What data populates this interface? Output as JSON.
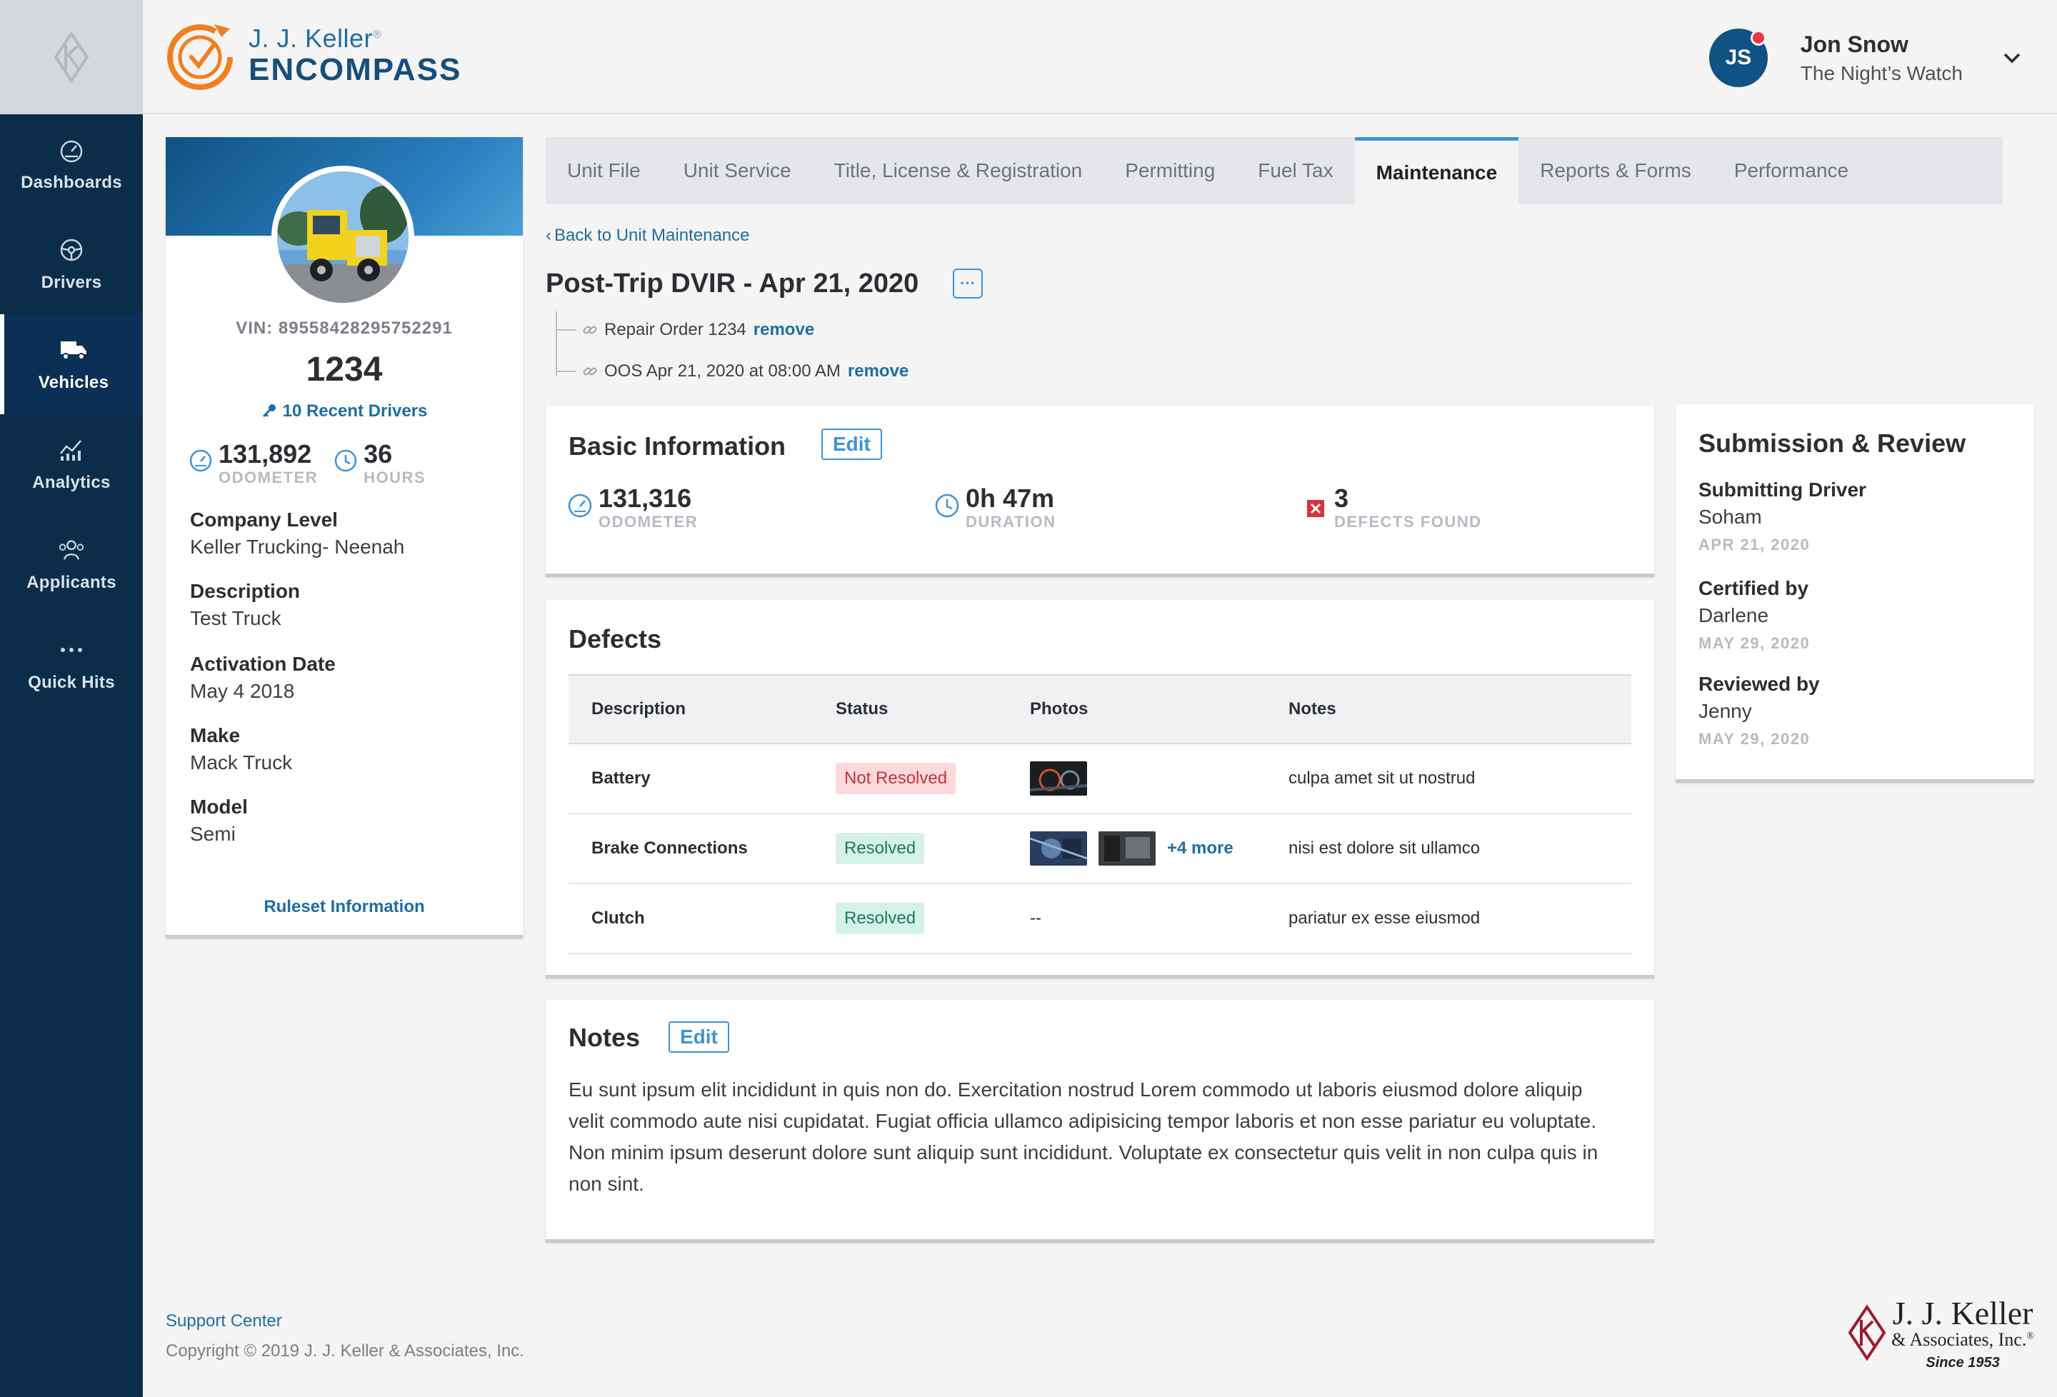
{
  "sidebar": {
    "items": [
      {
        "label": "Dashboards",
        "icon": "dashboard-icon"
      },
      {
        "label": "Drivers",
        "icon": "steering-wheel-icon"
      },
      {
        "label": "Vehicles",
        "icon": "truck-icon",
        "active": true
      },
      {
        "label": "Analytics",
        "icon": "analytics-icon"
      },
      {
        "label": "Applicants",
        "icon": "people-icon"
      },
      {
        "label": "Quick Hits",
        "icon": "ellipsis-icon"
      }
    ]
  },
  "header": {
    "brand_top": "J. J. Keller",
    "brand_reg": "®",
    "brand_bottom": "ENCOMPASS",
    "user": {
      "initials": "JS",
      "name": "Jon Snow",
      "org": "The Night’s Watch"
    }
  },
  "unit": {
    "vin": "VIN: 89558428295752291",
    "number": "1234",
    "recent_drivers": "10 Recent Drivers",
    "odometer_value": "131,892",
    "odometer_label": "ODOMETER",
    "hours_value": "36",
    "hours_label": "HOURS",
    "fields": [
      {
        "label": "Company Level",
        "value": "Keller Trucking- Neenah"
      },
      {
        "label": "Description",
        "value": "Test Truck"
      },
      {
        "label": "Activation Date",
        "value": "May 4 2018"
      },
      {
        "label": "Make",
        "value": "Mack Truck"
      },
      {
        "label": "Model",
        "value": "Semi"
      }
    ],
    "ruleset": "Ruleset Information"
  },
  "tabs": [
    {
      "label": "Unit File"
    },
    {
      "label": "Unit Service"
    },
    {
      "label": "Title, License & Registration"
    },
    {
      "label": "Permitting"
    },
    {
      "label": "Fuel Tax"
    },
    {
      "label": "Maintenance",
      "active": true
    },
    {
      "label": "Reports & Forms"
    },
    {
      "label": "Performance"
    }
  ],
  "page": {
    "back": "Back to Unit Maintenance",
    "title": "Post-Trip DVIR - Apr 21, 2020",
    "more": "···",
    "links": [
      {
        "text": "Repair Order 1234",
        "action": "remove"
      },
      {
        "text": "OOS Apr 21, 2020 at 08:00 AM",
        "action": "remove"
      }
    ]
  },
  "basic_info": {
    "title": "Basic Information",
    "edit": "Edit",
    "odometer_value": "131,316",
    "odometer_label": "ODOMETER",
    "duration_value": "0h 47m",
    "duration_label": "DURATION",
    "defects_value": "3",
    "defects_label": "DEFECTS FOUND"
  },
  "defects": {
    "title": "Defects",
    "columns": [
      "Description",
      "Status",
      "Photos",
      "Notes"
    ],
    "rows": [
      {
        "description": "Battery",
        "status": "Not Resolved",
        "photos": "",
        "notes": "culpa amet sit ut nostrud"
      },
      {
        "description": "Brake Connections",
        "status": "Resolved",
        "photos": "+4 more",
        "notes": "nisi est dolore sit ullamco"
      },
      {
        "description": "Clutch",
        "status": "Resolved",
        "photos": "--",
        "notes": "pariatur ex esse eiusmod"
      }
    ]
  },
  "notes": {
    "title": "Notes",
    "edit": "Edit",
    "text": "Eu sunt ipsum elit incididunt in quis non do. Exercitation nostrud Lorem commodo ut laboris eiusmod dolore aliquip velit commodo aute nisi cupidatat. Fugiat officia ullamco adipisicing tempor laboris et non esse pariatur eu voluptate. Non minim ipsum deserunt dolore sunt aliquip sunt incididunt. Voluptate ex consectetur quis velit in non culpa quis in non sint."
  },
  "submission": {
    "title": "Submission & Review",
    "items": [
      {
        "label": "Submitting Driver",
        "name": "Soham",
        "date": "APR 21, 2020"
      },
      {
        "label": "Certified by",
        "name": "Darlene",
        "date": "MAY 29, 2020"
      },
      {
        "label": "Reviewed by",
        "name": "Jenny",
        "date": "MAY 29, 2020"
      }
    ]
  },
  "footer": {
    "support": "Support Center",
    "copyright": "Copyright © 2019 J. J. Keller & Associates, Inc.",
    "logo_line1": "J. J. Keller",
    "logo_line2": "& Associates, Inc.",
    "logo_reg": "®",
    "logo_line3": "Since 1953"
  },
  "colors": {
    "sidebar": "#0c2d4a",
    "accent": "#1f6ea4",
    "brand_orange": "#f07f1f",
    "not_resolved": "#fbd9dc",
    "resolved": "#d5f2e7"
  }
}
